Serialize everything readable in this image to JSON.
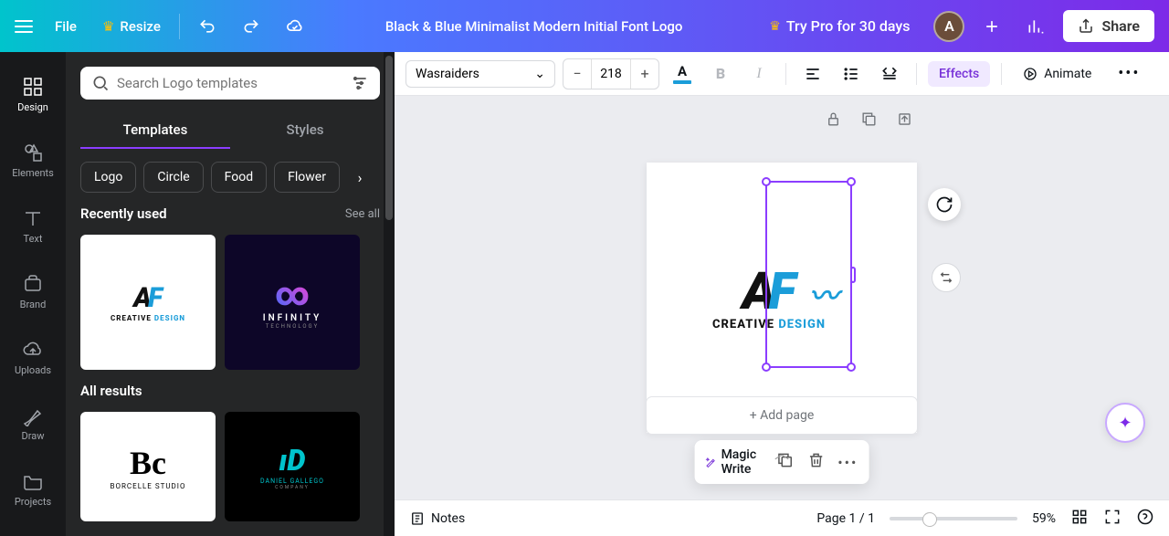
{
  "topbar": {
    "file": "File",
    "resize": "Resize",
    "title": "Black & Blue Minimalist Modern Initial Font Logo",
    "trypro": "Try Pro for 30 days",
    "avatar": "A",
    "share": "Share"
  },
  "far_sidebar": [
    {
      "label": "Design",
      "active": true
    },
    {
      "label": "Elements",
      "active": false
    },
    {
      "label": "Text",
      "active": false
    },
    {
      "label": "Brand",
      "active": false
    },
    {
      "label": "Uploads",
      "active": false
    },
    {
      "label": "Draw",
      "active": false
    },
    {
      "label": "Projects",
      "active": false
    }
  ],
  "side_panel": {
    "search_placeholder": "Search Logo templates",
    "tabs": [
      {
        "label": "Templates",
        "active": true
      },
      {
        "label": "Styles",
        "active": false
      }
    ],
    "chips": [
      "Logo",
      "Circle",
      "Food",
      "Flower"
    ],
    "recently_used": {
      "title": "Recently used",
      "see_all": "See all"
    },
    "all_results": {
      "title": "All results"
    },
    "thumb_infinity_title": "INFINITY",
    "thumb_infinity_sub": "TECHNOLOGY",
    "thumb_borcelle": "BORCELLE STUDIO",
    "thumb_gallego": "DANIEL GALLEGO",
    "thumb_gallego_sub": "COMPANY"
  },
  "toolbar": {
    "font": "Wasraiders",
    "size": "218",
    "effects": "Effects",
    "animate": "Animate",
    "colors": {
      "text_underline": "#1b9dd9"
    }
  },
  "context": {
    "magic_write": "Magic Write"
  },
  "canvas": {
    "add_page": "+ Add page",
    "logo_a": "A",
    "logo_f": "F",
    "logo_creative": "CREATIVE",
    "logo_design": "DESIGN"
  },
  "bottom": {
    "notes": "Notes",
    "page": "Page 1 / 1",
    "zoom": "59%"
  }
}
